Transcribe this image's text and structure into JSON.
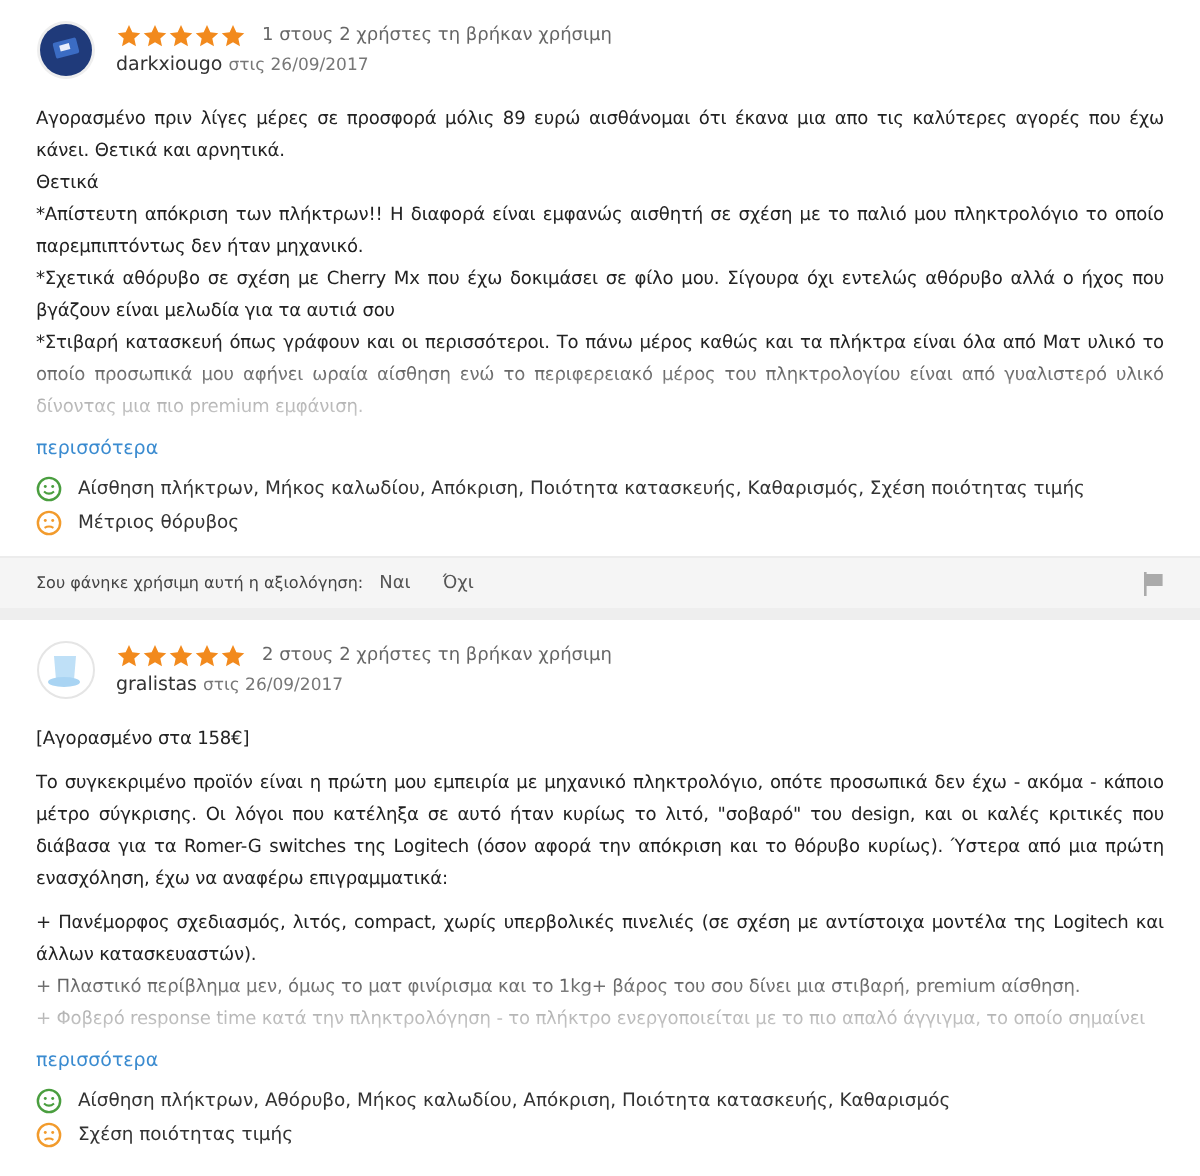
{
  "reviews": [
    {
      "avatar": {
        "kind": "dark"
      },
      "stars": 5,
      "helpful": "1 στους 2 χρήστες τη βρήκαν χρήσιμη",
      "author": "darkxiougo",
      "date": "στις 26/09/2017",
      "blocks": [
        [
          "Αγορασμένο πριν λίγες μέρες σε προσφορά μόλις 89 ευρώ αισθάνομαι ότι έκανα μια απο τις καλύτερες αγορές που έχω κάνει. Θετικά και αρνητικά.",
          "Θετικά",
          "*Απίστευτη απόκριση των πλήκτρων!! Η διαφορά είναι εμφανώς αισθητή σε σχέση με το παλιό μου πληκτρολόγιο το οποίο παρεμπιπτόντως δεν ήταν μηχανικό.",
          "*Σχετικά αθόρυβο σε σχέση με Cherry Mx που έχω δοκιμάσει σε φίλο μου. Σίγουρα όχι εντελώς αθόρυβο αλλά ο ήχος που βγάζουν είναι μελωδία για τα αυτιά σου",
          "*Στιβαρή κατασκευή όπως γράφουν και οι περισσότεροι. Το πάνω μέρος καθώς και τα πλήκτρα είναι όλα από Ματ υλικό το οποίο προσωπικά μου αφήνει ωραία αίσθηση ενώ το περιφερειακό μέρος του πληκτρολογίου είναι από γυαλιστερό υλικό δίνοντας μια πιο premium εμφάνιση."
        ]
      ],
      "more": "περισσότερα",
      "pros": "Αίσθηση πλήκτρων, Μήκος καλωδίου, Απόκριση, Ποιότητα κατασκευής, Καθαρισμός, Σχέση ποιότητας τιμής",
      "cons": "Μέτριος θόρυβος",
      "feedback": {
        "question": "Σου φάνηκε χρήσιμη αυτή η αξιολόγηση:",
        "yes": "Ναι",
        "no": "Όχι"
      }
    },
    {
      "avatar": {
        "kind": "hat"
      },
      "stars": 5,
      "helpful": "2 στους 2 χρήστες τη βρήκαν χρήσιμη",
      "author": "gralistas",
      "date": "στις 26/09/2017",
      "blocks": [
        [
          "[Αγορασμένο στα 158€]"
        ],
        [
          "Το συγκεκριμένο προϊόν είναι η πρώτη μου εμπειρία με μηχανικό πληκτρολόγιο, οπότε προσωπικά δεν έχω - ακόμα - κάποιο μέτρο σύγκρισης. Οι λόγοι που κατέληξα σε αυτό ήταν κυρίως το λιτό, \"σοβαρό\" του design, και οι καλές κριτικές που διάβασα για τα Romer-G switches της Logitech (όσον αφορά την απόκριση και το θόρυβο κυρίως). Ύστερα από μια πρώτη ενασχόληση, έχω να αναφέρω επιγραμματικά:"
        ],
        [
          "+ Πανέμορφος σχεδιασμός, λιτός, compact, χωρίς υπερβολικές πινελιές (σε σχέση με αντίστοιχα μοντέλα της Logitech και άλλων κατασκευαστών).",
          "+ Πλαστικό περίβλημα μεν, όμως το ματ φινίρισμα και το 1kg+ βάρος του σου δίνει μια στιβαρή, premium αίσθηση.",
          "+ Φοβερό response time κατά την πληκτρολόγηση - το πλήκτρο ενεργοποιείται με το πιο απαλό άγγιγμα, το οποίο σημαίνει"
        ]
      ],
      "more": "περισσότερα",
      "pros": "Αίσθηση πλήκτρων, Αθόρυβο, Μήκος καλωδίου, Απόκριση, Ποιότητα κατασκευής, Καθαρισμός",
      "cons": "Σχέση ποιότητας τιμής"
    }
  ]
}
